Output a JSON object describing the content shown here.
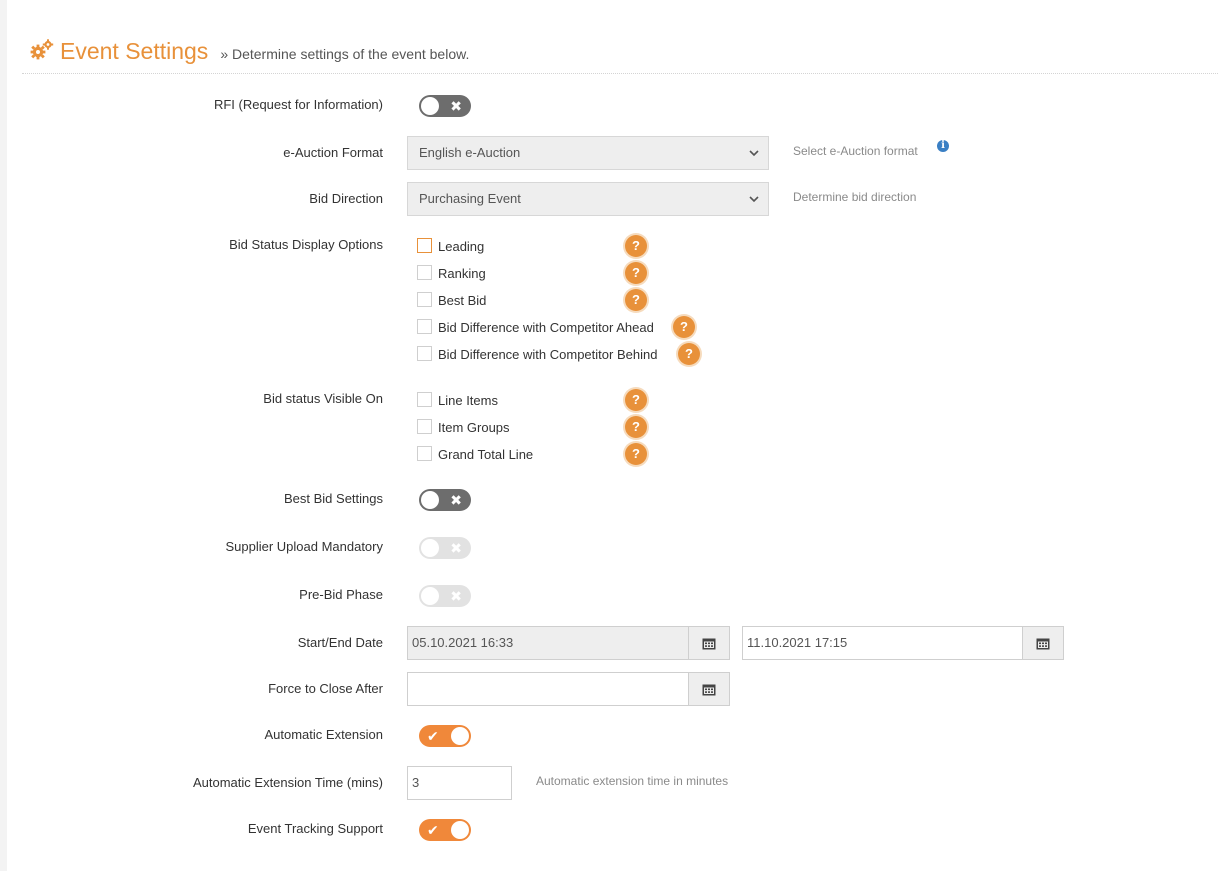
{
  "header": {
    "title": "Event Settings",
    "subtitle": "» Determine settings of the event below."
  },
  "rfi": {
    "label": "RFI (Request for Information)",
    "state": "off"
  },
  "auction_format": {
    "label": "e-Auction Format",
    "value": "English e-Auction",
    "hint": "Select e-Auction format"
  },
  "bid_direction": {
    "label": "Bid Direction",
    "value": "Purchasing Event",
    "hint": "Determine bid direction"
  },
  "bid_status_display": {
    "label": "Bid Status Display Options",
    "options": [
      {
        "label": "Leading",
        "checked": false
      },
      {
        "label": "Ranking",
        "checked": false
      },
      {
        "label": "Best Bid",
        "checked": false
      },
      {
        "label": "Bid Difference with Competitor Ahead",
        "checked": false
      },
      {
        "label": "Bid Difference with Competitor Behind",
        "checked": false
      }
    ]
  },
  "bid_status_visible": {
    "label": "Bid status Visible On",
    "options": [
      {
        "label": "Line Items",
        "checked": false
      },
      {
        "label": "Item Groups",
        "checked": false
      },
      {
        "label": "Grand Total Line",
        "checked": false
      }
    ]
  },
  "best_bid_settings": {
    "label": "Best Bid Settings",
    "state": "off"
  },
  "supplier_upload": {
    "label": "Supplier Upload Mandatory",
    "state": "disabled"
  },
  "pre_bid": {
    "label": "Pre-Bid Phase",
    "state": "disabled"
  },
  "start_end_date": {
    "label": "Start/End Date",
    "start": "05.10.2021 16:33",
    "end": "11.10.2021 17:15"
  },
  "force_close": {
    "label": "Force to Close After",
    "value": ""
  },
  "auto_extension": {
    "label": "Automatic Extension",
    "state": "on"
  },
  "auto_extension_time": {
    "label": "Automatic Extension Time (mins)",
    "value": "3",
    "hint": "Automatic extension time in minutes"
  },
  "event_tracking": {
    "label": "Event Tracking Support",
    "state": "on"
  },
  "glyphs": {
    "question": "?",
    "info": "i",
    "check": "✔",
    "cross": "✖"
  },
  "colors": {
    "accent": "#e8913a",
    "toggle_on": "#f0883a",
    "toggle_off": "#6d6d6d",
    "info": "#3a7fc4"
  }
}
